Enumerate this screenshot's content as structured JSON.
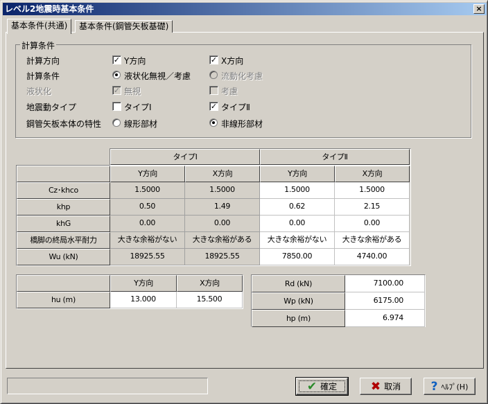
{
  "window": {
    "title": "レベル2地震時基本条件",
    "close": "×"
  },
  "tabs": [
    {
      "label": "基本条件(共通)"
    },
    {
      "label": "基本条件(鋼管矢板基礎)"
    }
  ],
  "group": {
    "title": "計算条件",
    "rows": [
      {
        "label": "計算方向",
        "opt1": "Y方向",
        "opt2": "X方向"
      },
      {
        "label": "計算条件",
        "opt1": "液状化無視／考慮",
        "opt2": "流動化考慮"
      },
      {
        "label": "液状化",
        "opt1": "無視",
        "opt2": "考慮"
      },
      {
        "label": "地震動タイプ",
        "opt1": "タイプⅠ",
        "opt2": "タイプⅡ"
      },
      {
        "label": "鋼管矢板本体の特性",
        "opt1": "線形部材",
        "opt2": "非線形部材"
      }
    ]
  },
  "table1": {
    "groups": [
      "タイプⅠ",
      "タイプⅡ"
    ],
    "cols": [
      "Y方向",
      "X方向",
      "Y方向",
      "X方向"
    ],
    "rows": [
      {
        "label": "Cz･khco",
        "values": [
          "1.5000",
          "1.5000",
          "1.5000",
          "1.5000"
        ]
      },
      {
        "label": "khp",
        "values": [
          "0.50",
          "1.49",
          "0.62",
          "2.15"
        ]
      },
      {
        "label": "khG",
        "values": [
          "0.00",
          "0.00",
          "0.00",
          "0.00"
        ]
      },
      {
        "label": "橋脚の終局水平耐力",
        "values": [
          "大きな余裕がない",
          "大きな余裕がある",
          "大きな余裕がない",
          "大きな余裕がある"
        ]
      },
      {
        "label": "Wu (kN)",
        "values": [
          "18925.55",
          "18925.55",
          "7850.00",
          "4740.00"
        ]
      }
    ]
  },
  "table2": {
    "cols": [
      "Y方向",
      "X方向"
    ],
    "rows": [
      {
        "label": "hu (m)",
        "values": [
          "13.000",
          "15.500"
        ]
      }
    ]
  },
  "table3": {
    "rows": [
      {
        "label": "Rd (kN)",
        "value": "7100.00"
      },
      {
        "label": "Wp (kN)",
        "value": "6175.00"
      },
      {
        "label": "hp (m)",
        "value": "6.974"
      }
    ]
  },
  "buttons": {
    "ok": "確定",
    "cancel": "取消",
    "help": "ﾍﾙﾌﾟ(H)"
  }
}
